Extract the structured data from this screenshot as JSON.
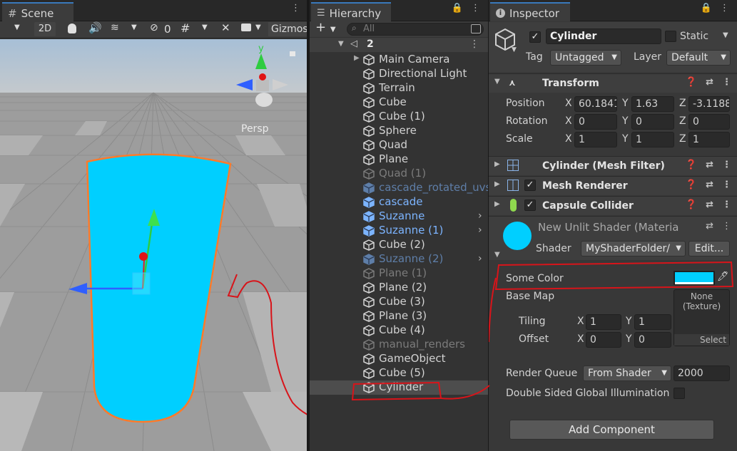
{
  "scene": {
    "tab_label": "Scene",
    "toolbar": {
      "mode_2d": "2D",
      "hidden_count": "0",
      "gizmos": "Gizmos"
    },
    "gizmo": {
      "y_label": "y",
      "persp_label": "Persp"
    }
  },
  "hierarchy": {
    "tab_label": "Hierarchy",
    "search_placeholder": "All",
    "scene_name": "2",
    "items": [
      {
        "label": "Main Camera",
        "style": "normal",
        "expand": true,
        "chevron": false
      },
      {
        "label": "Directional Light",
        "style": "normal",
        "expand": false,
        "chevron": false
      },
      {
        "label": "Terrain",
        "style": "normal",
        "expand": false,
        "chevron": false
      },
      {
        "label": "Cube",
        "style": "normal",
        "expand": false,
        "chevron": false
      },
      {
        "label": "Cube (1)",
        "style": "normal",
        "expand": false,
        "chevron": false
      },
      {
        "label": "Sphere",
        "style": "normal",
        "expand": false,
        "chevron": false
      },
      {
        "label": "Quad",
        "style": "normal",
        "expand": false,
        "chevron": false
      },
      {
        "label": "Plane",
        "style": "normal",
        "expand": false,
        "chevron": false
      },
      {
        "label": "Quad (1)",
        "style": "disabled",
        "expand": false,
        "chevron": false
      },
      {
        "label": "cascade_rotated_uvs",
        "style": "prefab-disabled",
        "expand": false,
        "chevron": false
      },
      {
        "label": "cascade",
        "style": "prefab",
        "expand": false,
        "chevron": false
      },
      {
        "label": "Suzanne",
        "style": "prefab",
        "expand": false,
        "chevron": true
      },
      {
        "label": "Suzanne (1)",
        "style": "prefab",
        "expand": false,
        "chevron": true
      },
      {
        "label": "Cube (2)",
        "style": "normal",
        "expand": false,
        "chevron": false
      },
      {
        "label": "Suzanne (2)",
        "style": "prefab-disabled",
        "expand": false,
        "chevron": true
      },
      {
        "label": "Plane (1)",
        "style": "disabled",
        "expand": false,
        "chevron": false
      },
      {
        "label": "Plane (2)",
        "style": "normal",
        "expand": false,
        "chevron": false
      },
      {
        "label": "Cube (3)",
        "style": "normal",
        "expand": false,
        "chevron": false
      },
      {
        "label": "Plane (3)",
        "style": "normal",
        "expand": false,
        "chevron": false
      },
      {
        "label": "Cube (4)",
        "style": "normal",
        "expand": false,
        "chevron": false
      },
      {
        "label": "manual_renders",
        "style": "disabled",
        "expand": false,
        "chevron": false
      },
      {
        "label": "GameObject",
        "style": "normal",
        "expand": false,
        "chevron": false
      },
      {
        "label": "Cube (5)",
        "style": "normal",
        "expand": false,
        "chevron": false
      },
      {
        "label": "Cylinder",
        "style": "selected",
        "expand": false,
        "chevron": false
      }
    ]
  },
  "inspector": {
    "tab_label": "Inspector",
    "object_name": "Cylinder",
    "static_label": "Static",
    "tag_label": "Tag",
    "tag_value": "Untagged",
    "layer_label": "Layer",
    "layer_value": "Default",
    "transform": {
      "title": "Transform",
      "position_label": "Position",
      "rotation_label": "Rotation",
      "scale_label": "Scale",
      "position": {
        "x": "60.1841",
        "y": "1.63",
        "z": "-3.1188"
      },
      "rotation": {
        "x": "0",
        "y": "0",
        "z": "0"
      },
      "scale": {
        "x": "1",
        "y": "1",
        "z": "1"
      }
    },
    "components": {
      "mesh_filter": "Cylinder (Mesh Filter)",
      "mesh_renderer": "Mesh Renderer",
      "capsule_collider": "Capsule Collider"
    },
    "material": {
      "name": "New Unlit Shader (Materia",
      "shader_label": "Shader",
      "shader_value": "MyShaderFolder/",
      "edit_button": "Edit...",
      "color_hex": "#00cfff",
      "some_color_label": "Some Color",
      "base_map_label": "Base Map",
      "texture_none_line1": "None",
      "texture_none_line2": "(Texture)",
      "select_button": "Select",
      "tiling_label": "Tiling",
      "offset_label": "Offset",
      "tiling": {
        "x": "1",
        "y": "1"
      },
      "offset": {
        "x": "0",
        "y": "0"
      },
      "render_queue_label": "Render Queue",
      "render_queue_mode": "From Shader",
      "render_queue_value": "2000",
      "gi_label": "Double Sided Global Illumination"
    },
    "add_component": "Add Component",
    "axis": {
      "x": "X",
      "y": "Y",
      "z": "Z"
    }
  },
  "colors": {
    "accent": "#3a79bb",
    "selection": "#4d4d4d",
    "prefab_text": "#7cb4ff",
    "annotation": "#d8141a",
    "shape_fill": "#00cfff",
    "outline": "#ff7a2a"
  }
}
